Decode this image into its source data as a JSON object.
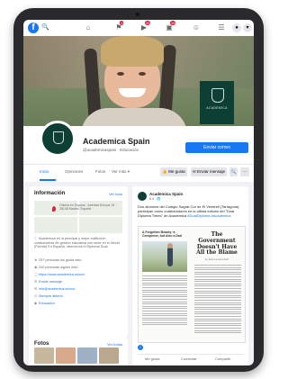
{
  "topbar": {
    "logo": "f",
    "search_icon": "search-icon",
    "badges": [
      "1",
      "20",
      "10"
    ],
    "icons": [
      "home-icon",
      "flag-icon",
      "video-icon",
      "store-icon",
      "groups-icon",
      "menu-icon"
    ]
  },
  "cover": {
    "sign_text": "ACADEMICA"
  },
  "page": {
    "name": "Academica Spain",
    "subtitle": "@academicaspain · Educación",
    "send_button": "Enviar correo",
    "tabs": [
      "Inicio",
      "Opiniones",
      "Fotos",
      "Ver más ▾"
    ],
    "actions": {
      "like": "👍 Me gusta",
      "message": "✉ Enviar mensaje",
      "search": "🔍",
      "more": "···"
    }
  },
  "info": {
    "title": "Información",
    "see_all": "Ver todo",
    "map_address": "Oficina en Espana · Avenida Europa 15 · 28108 Madrid, España",
    "description": "Academica es la principal y mejor institución colaboradora de gestión educativa con sede en el World (Florida) En España, ofrecemos el Diploma Dual",
    "rows": [
      "257 personas les gusta esto",
      "240 personas siguen esto",
      "https://www.academica.school",
      "Enviar mensaje",
      "info@academica.school",
      "Siempre abierto",
      "Educación"
    ]
  },
  "photos": {
    "title": "Fotos",
    "see_all": "Ver todas"
  },
  "post": {
    "author": "Academica Spain",
    "time": "8 d · 🌐",
    "text_prefix": "Dos alumnos del Colegio Sagrat Cor de El Vendrell (Tarragona) participan como colaboradores en la última edición del \"Dual Diploma Times\" de Academica",
    "text_hashtag": "#DualDiploma #Academica",
    "news_left_headline": "A Forgotten Beauty: a Conqueror, but Also a Dad",
    "news_right_headline": "The Government Doesn't Have All the Blame",
    "news_byline": "by Jana Herrera Ruiz",
    "likes": "👍",
    "action_like": "Me gusta",
    "action_comment": "Comentar",
    "action_share": "Compartir"
  },
  "colors": {
    "fb_blue": "#1877f2",
    "academica_green": "#0e3f35",
    "background": "#f0f2f5"
  }
}
